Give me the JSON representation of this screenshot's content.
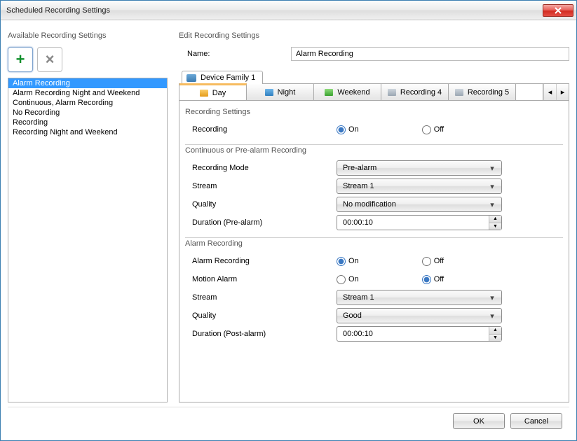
{
  "window": {
    "title": "Scheduled Recording Settings"
  },
  "left": {
    "heading": "Available Recording Settings",
    "items": [
      "Alarm Recording",
      "Alarm Recording Night and Weekend",
      "Continuous, Alarm Recording",
      "No Recording",
      "Recording",
      "Recording Night and Weekend"
    ],
    "selected_index": 0
  },
  "right": {
    "heading": "Edit Recording Settings",
    "name_label": "Name:",
    "name_value": "Alarm Recording",
    "device_tab": "Device Family 1",
    "rec_tabs": [
      "Day",
      "Night",
      "Weekend",
      "Recording 4",
      "Recording 5"
    ],
    "sections": {
      "recording_settings": "Recording Settings",
      "recording_label": "Recording",
      "on": "On",
      "off": "Off",
      "continuous": "Continuous or Pre-alarm Recording",
      "mode_label": "Recording Mode",
      "mode_value": "Pre-alarm",
      "stream_label": "Stream",
      "stream_value": "Stream 1",
      "quality_label": "Quality",
      "quality_value": "No modification",
      "duration_pre_label": "Duration (Pre-alarm)",
      "duration_pre_value": "00:00:10",
      "alarm_section": "Alarm Recording",
      "alarm_rec_label": "Alarm Recording",
      "motion_label": "Motion Alarm",
      "alarm_stream_label": "Stream",
      "alarm_stream_value": "Stream 1",
      "alarm_quality_label": "Quality",
      "alarm_quality_value": "Good",
      "duration_post_label": "Duration (Post-alarm)",
      "duration_post_value": "00:00:10"
    }
  },
  "footer": {
    "ok": "OK",
    "cancel": "Cancel"
  }
}
